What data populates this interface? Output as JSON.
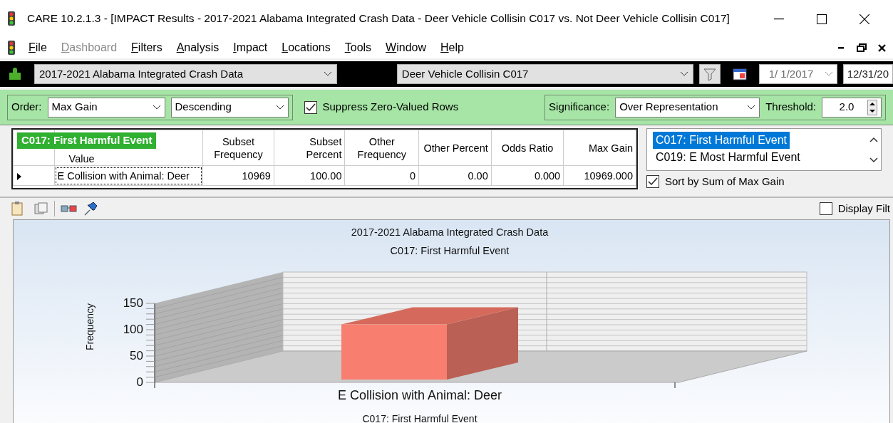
{
  "window": {
    "title": "CARE 10.2.1.3 - [IMPACT Results - 2017-2021 Alabama Integrated Crash Data - Deer Vehicle Collisin C017 vs. Not Deer Vehicle Collisin C017]"
  },
  "menu": [
    {
      "label": "File",
      "disabled": false
    },
    {
      "label": "Dashboard",
      "disabled": true
    },
    {
      "label": "Filters",
      "disabled": false
    },
    {
      "label": "Analysis",
      "disabled": false
    },
    {
      "label": "Impact",
      "disabled": false
    },
    {
      "label": "Locations",
      "disabled": false
    },
    {
      "label": "Tools",
      "disabled": false
    },
    {
      "label": "Window",
      "disabled": false
    },
    {
      "label": "Help",
      "disabled": false
    }
  ],
  "toolbar": {
    "database": "2017-2021 Alabama Integrated Crash Data",
    "filter": "Deer Vehicle Collisin C017",
    "date_from": "1/ 1/2017",
    "date_to": "12/31/20"
  },
  "options": {
    "order_label": "Order:",
    "order": "Max Gain",
    "direction": "Descending",
    "suppress": {
      "label": "Suppress Zero-Valued Rows",
      "checked": true
    },
    "significance_label": "Significance:",
    "significance": "Over Representation",
    "threshold_label": "Threshold:",
    "threshold": "2.0"
  },
  "grid": {
    "group_label": "C017: First Harmful Event",
    "columns": [
      "Value",
      "Subset Frequency",
      "Subset Percent",
      "Other Frequency",
      "Other Percent",
      "Odds Ratio",
      "Max Gain"
    ],
    "rows": [
      {
        "selected": true,
        "cells": [
          "E Collision with Animal: Deer",
          "10969",
          "100.00",
          "0",
          "0.00",
          "0.000",
          "10969.000"
        ]
      }
    ]
  },
  "variables": {
    "items": [
      {
        "label": "C017: First Harmful Event",
        "selected": true
      },
      {
        "label": "C019: E Most Harmful Event",
        "selected": false
      }
    ],
    "sort": {
      "label": "Sort by Sum of Max Gain",
      "checked": true
    }
  },
  "chart_panel": {
    "display_filters": {
      "label": "Display Filt",
      "checked": false
    },
    "chart": {
      "title": "2017-2021 Alabama Integrated Crash Data",
      "subtitle": "C017: First Harmful Event",
      "y_axis_title": "Frequency",
      "y_axis_labels": [
        "150",
        "100",
        "50",
        "0"
      ],
      "category_label": "E Collision with Animal: Deer",
      "x_axis_title": "C017: First Harmful Event"
    }
  }
}
